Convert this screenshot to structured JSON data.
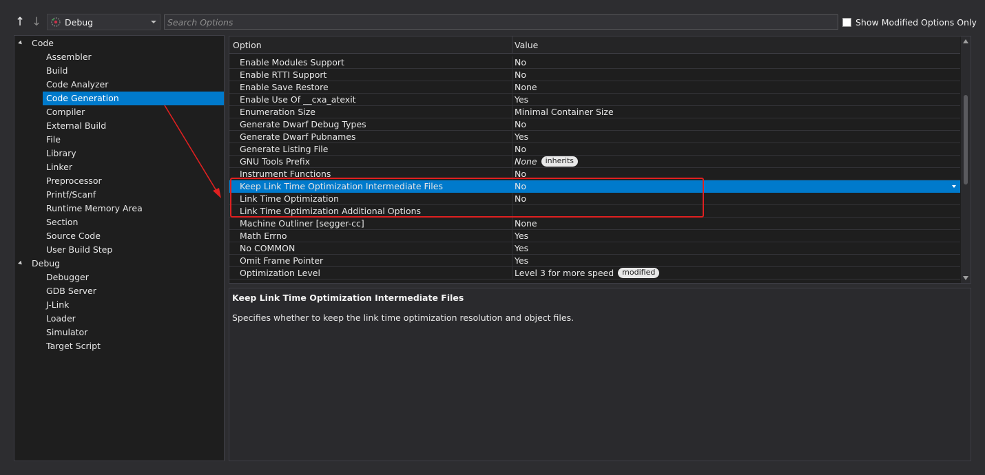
{
  "toolbar": {
    "up_arrow": "↑",
    "down_arrow": "↓",
    "configuration": "Debug",
    "search_placeholder": "Search Options",
    "show_modified_label": "Show Modified Options Only"
  },
  "tree": {
    "groups": [
      {
        "label": "Code",
        "items": [
          "Assembler",
          "Build",
          "Code Analyzer",
          "Code Generation",
          "Compiler",
          "External Build",
          "File",
          "Library",
          "Linker",
          "Preprocessor",
          "Printf/Scanf",
          "Runtime Memory Area",
          "Section",
          "Source Code",
          "User Build Step"
        ]
      },
      {
        "label": "Debug",
        "items": [
          "Debugger",
          "GDB Server",
          "J-Link",
          "Loader",
          "Simulator",
          "Target Script"
        ]
      }
    ],
    "selected": "Code Generation"
  },
  "grid": {
    "header_option": "Option",
    "header_value": "Value",
    "rows": [
      {
        "option": "Enable Modules Support",
        "value": "No"
      },
      {
        "option": "Enable RTTI Support",
        "value": "No"
      },
      {
        "option": "Enable Save Restore",
        "value": "None"
      },
      {
        "option": "Enable Use Of __cxa_atexit",
        "value": "Yes"
      },
      {
        "option": "Enumeration Size",
        "value": "Minimal Container Size"
      },
      {
        "option": "Generate Dwarf Debug Types",
        "value": "No"
      },
      {
        "option": "Generate Dwarf Pubnames",
        "value": "Yes"
      },
      {
        "option": "Generate Listing File",
        "value": "No"
      },
      {
        "option": "GNU Tools Prefix",
        "value": "None",
        "italic": true,
        "badge": "inherits"
      },
      {
        "option": "Instrument Functions",
        "value": "No"
      },
      {
        "option": "Keep Link Time Optimization Intermediate Files",
        "value": "No",
        "selected": true
      },
      {
        "option": "Link Time Optimization",
        "value": "No"
      },
      {
        "option": "Link Time Optimization Additional Options",
        "value": ""
      },
      {
        "option": "Machine Outliner [segger-cc]",
        "value": "None"
      },
      {
        "option": "Math Errno",
        "value": "Yes"
      },
      {
        "option": "No COMMON",
        "value": "Yes"
      },
      {
        "option": "Omit Frame Pointer",
        "value": "Yes"
      },
      {
        "option": "Optimization Level",
        "value": "Level 3 for more speed",
        "badge": "modified"
      }
    ]
  },
  "description": {
    "title": "Keep Link Time Optimization Intermediate Files",
    "text": "Specifies whether to keep the link time optimization resolution and object files."
  },
  "colors": {
    "selection": "#007acc",
    "annotation": "#e02020",
    "background": "#2d2d30",
    "panel": "#1e1e1e"
  },
  "icons": {
    "config": "configuration-icon",
    "annotation_arrow": "red-arrow-annotation"
  }
}
